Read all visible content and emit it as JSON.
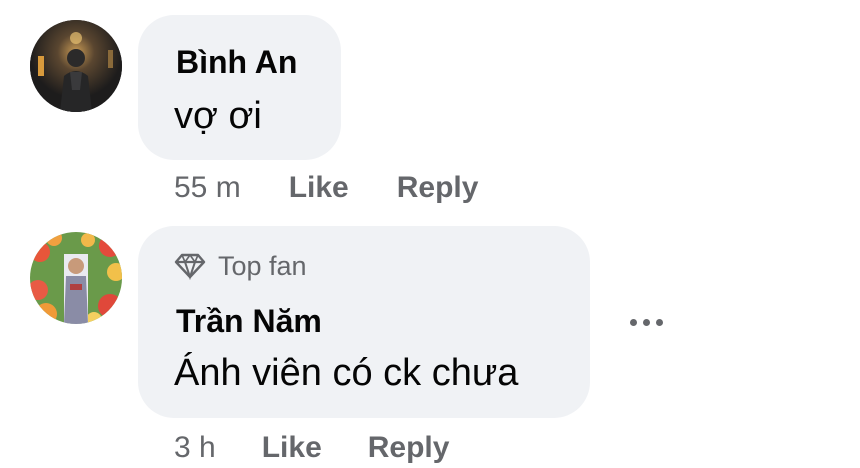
{
  "comments": [
    {
      "author": "Bình An",
      "text": "vợ ơi",
      "time": "55 m",
      "like_label": "Like",
      "reply_label": "Reply",
      "avatar_icon": "user-avatar-dark-photo"
    },
    {
      "badge": "Top fan",
      "badge_icon": "diamond-icon",
      "author": "Trần Năm",
      "text": "Ánh viên có ck chưa",
      "time": "3 h",
      "like_label": "Like",
      "reply_label": "Reply",
      "avatar_icon": "user-avatar-flowers-photo",
      "more_icon": "more-options-icon"
    }
  ],
  "colors": {
    "bubble": "#f0f2f5",
    "text": "#050505",
    "secondary": "#65676b",
    "background": "#ffffff"
  }
}
